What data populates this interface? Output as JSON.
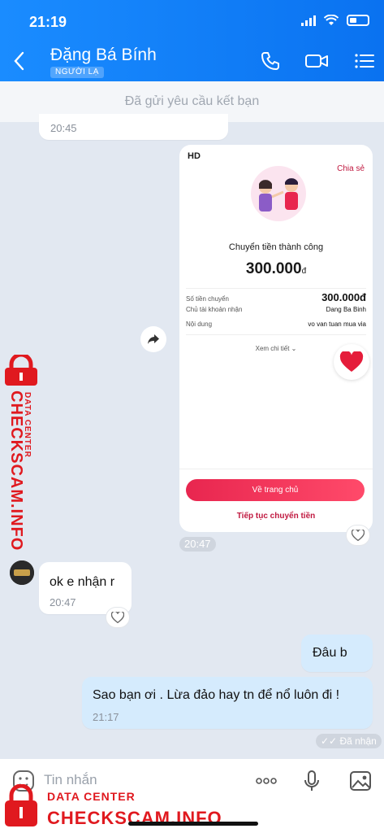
{
  "status": {
    "time": "21:19"
  },
  "header": {
    "contact_name": "Đặng Bá Bính",
    "badge": "NGƯỜI LẠ"
  },
  "friend_request": {
    "text": "Đã gửi yêu cầu kết bạn"
  },
  "messages": {
    "prev_time": "20:45",
    "card": {
      "hd": "HD",
      "share": "Chia sẻ",
      "title": "Chuyển tiền thành công",
      "amount": "300.000",
      "currency": "đ",
      "rows": [
        {
          "label": "Số tiền chuyển",
          "value": "300.000đ"
        },
        {
          "label": "Chủ tài khoản nhận",
          "value": "Dang Ba Binh"
        },
        {
          "label": "Nội dung",
          "value": "vo van tuan mua via"
        }
      ],
      "detail": "Xem chi tiết",
      "home_button": "Về trang chủ",
      "continue": "Tiếp tục chuyển tiền",
      "time": "20:47"
    },
    "reply1": {
      "text": "ok e nhận r",
      "time": "20:47"
    },
    "out1": {
      "text": "Đâu b"
    },
    "out2": {
      "text": "Sao bạn ơi . Lừa đảo hay tn để nổ luôn đi !",
      "time": "21:17"
    },
    "seen": "✓✓ Đã nhận"
  },
  "input": {
    "placeholder": "Tin nhắn"
  },
  "watermark": {
    "label": "DATA CENTER",
    "site": "CHECKSCAM.INFO"
  },
  "colors": {
    "header": "#0a72f0",
    "accent_red": "#e8264f",
    "watermark": "#e0191f"
  }
}
